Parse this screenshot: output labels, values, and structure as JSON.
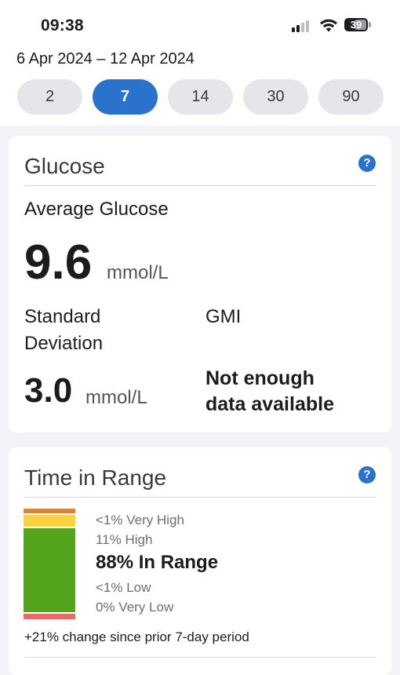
{
  "status_bar": {
    "time": "09:38",
    "battery": "39"
  },
  "date_range": "6 Apr 2024 – 12 Apr 2024",
  "periods": {
    "options": [
      "2",
      "7",
      "14",
      "30",
      "90"
    ],
    "selected": "7"
  },
  "glucose_card": {
    "title": "Glucose",
    "help": "?",
    "average_label": "Average Glucose",
    "average_value": "9.6",
    "average_unit": "mmol/L",
    "sd_label_line1": "Standard",
    "sd_label_line2": "Deviation",
    "sd_value": "3.0",
    "sd_unit": "mmol/L",
    "gmi_label": "GMI",
    "gmi_value_line1": "Not enough",
    "gmi_value_line2": "data available"
  },
  "time_in_range_card": {
    "title": "Time in Range",
    "help": "?",
    "very_high": "<1% Very High",
    "high": "11% High",
    "in_range": "88% In Range",
    "low": "<1% Low",
    "very_low": "0% Very Low",
    "change_note": "+21% change since prior 7-day period",
    "bar_percentages": {
      "very_high": 1,
      "high": 11,
      "in_range": 88,
      "low": 1,
      "very_low": 0
    },
    "colors": {
      "very_high": "#e0822a",
      "high": "#ffd23c",
      "in_range": "#55a51c",
      "low": "#ea6a6a",
      "very_low": "#c62828"
    }
  }
}
